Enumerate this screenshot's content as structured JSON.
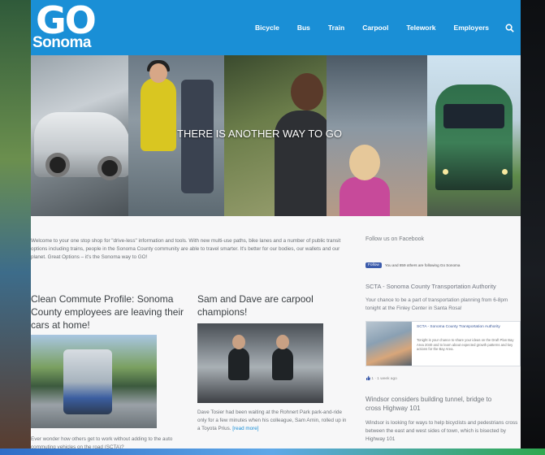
{
  "header": {
    "logo_top": "GO",
    "logo_bottom": "Sonoma",
    "nav": [
      "Bicycle",
      "Bus",
      "Train",
      "Carpool",
      "Telework",
      "Employers"
    ],
    "brand_color": "#1a8fd6"
  },
  "hero": {
    "caption": "THERE IS ANOTHER WAY TO GO"
  },
  "welcome": {
    "text": "Welcome to your one stop shop for \"drive-less\" information and tools. With new multi-use paths, bike lanes and a number of public transit options including trains, people in the Sonoma County community are able to travel smarter. It's better for our bodies, our wallets and our planet. Great Options – it's the Sonoma way to GO!"
  },
  "posts": [
    {
      "title": "Clean Commute Profile: Sonoma County employees are leaving their cars at home!",
      "excerpt": "Ever wonder how others get to work without adding to the auto commuting vehicles on the road (SCTA)?"
    },
    {
      "title": "Sam and Dave are carpool champions!",
      "excerpt": "Dave Tosier had been waiting at the Rohnert Park park-and-ride only for a few minutes when his colleague, Sam Arnin, rolled up in a Toyota Prius.",
      "read_more": "[read more]"
    }
  ],
  "facebook": {
    "heading": "Follow us on Facebook",
    "follow_button": "Follow",
    "follow_text": "You and 859 others are following Go Sonoma",
    "page_title": "SCTA - Sonoma County Transportation Authority",
    "post_text": "Your chance to be a part of transportation planning from 6-8pm tonight at the Finley Center in Santa Rosa!",
    "card_title": "SCTA - Sonoma County Transportation Authority",
    "card_text": "Tonight is your chance to share your ideas on the Draft Plan Bay Area 2040 and to learn about expected growth patterns and key actions for the Bay Area.",
    "meta": "1 · 1 week ago",
    "headline2": "Windsor considers building tunnel, bridge to cross Highway 101",
    "post2": "Windsor is looking for ways to help bicyclists and pedestrians cross between the east and west sides of town, which is bisected by Highway 101"
  }
}
